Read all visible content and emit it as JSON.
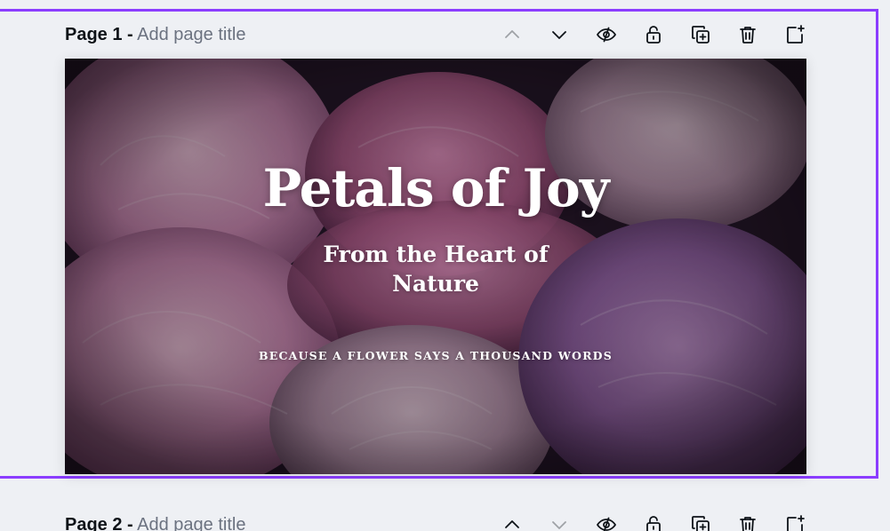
{
  "pages": [
    {
      "label": "Page 1 -",
      "title_placeholder": "Add page title",
      "selected": true
    },
    {
      "label": "Page 2 -",
      "title_placeholder": "Add page title",
      "selected": false
    }
  ],
  "toolbar_icons": [
    "chevron-up-icon",
    "chevron-down-icon",
    "hide-eye-icon",
    "lock-icon",
    "duplicate-icon",
    "trash-icon",
    "add-page-icon"
  ],
  "design": {
    "headline": "Petals of Joy",
    "subhead_line1": "From the Heart of",
    "subhead_line2": "Nature",
    "tagline": "BECAUSE A FLOWER SAYS A THOUSAND WORDS"
  },
  "colors": {
    "selection_border": "#8b3dff",
    "background": "#eef0f4",
    "text_dark": "#0e1318",
    "text_muted": "#6b7280"
  }
}
